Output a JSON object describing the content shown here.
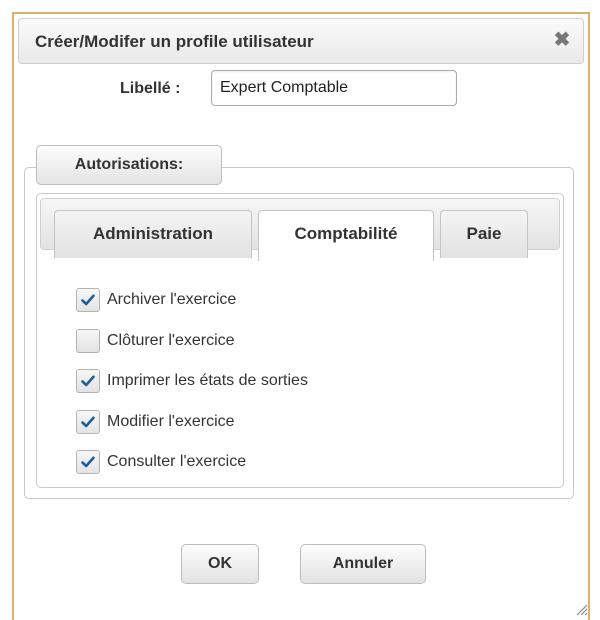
{
  "dialog": {
    "title": "Créer/Modifer un profile utilisateur",
    "close_icon": "close-icon",
    "accent_border": "#d9b168"
  },
  "form": {
    "libelle_label": "Libellé :",
    "libelle_value": "Expert Comptable"
  },
  "autorisations": {
    "legend": "Autorisations:",
    "tabs": [
      {
        "label": "Administration",
        "active": false
      },
      {
        "label": "Comptabilité",
        "active": true
      },
      {
        "label": "Paie",
        "active": false
      }
    ],
    "permissions": [
      {
        "label": "Archiver l'exercice",
        "checked": true
      },
      {
        "label": "Clôturer l'exercice",
        "checked": false
      },
      {
        "label": "Imprimer les états de sorties",
        "checked": true
      },
      {
        "label": "Modifier l'exercice",
        "checked": true
      },
      {
        "label": "Consulter l'exercice",
        "checked": true
      }
    ]
  },
  "buttons": {
    "ok": "OK",
    "cancel": "Annuler"
  }
}
